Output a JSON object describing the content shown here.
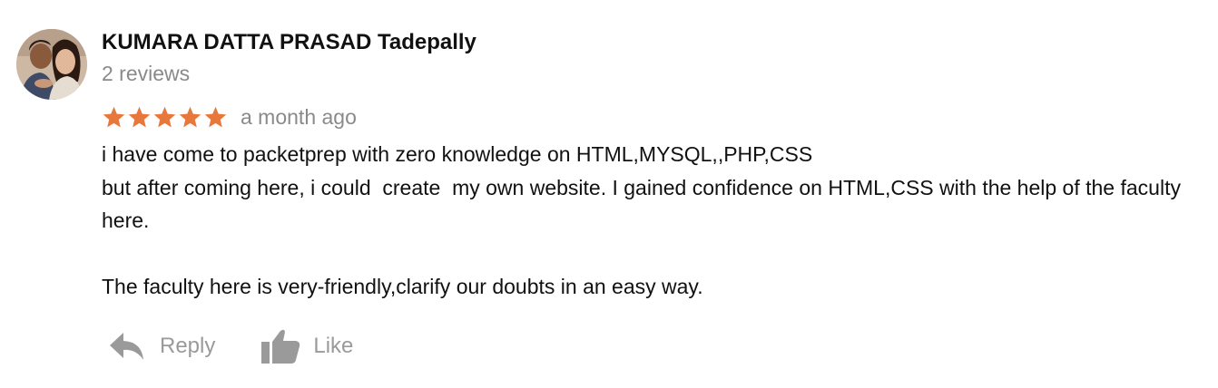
{
  "review": {
    "author_name": "KUMARA DATTA PRASAD Tadepally",
    "review_count": "2 reviews",
    "avatar_icon": "profile-photo",
    "rating": 5,
    "rating_max": 5,
    "star_color": "#e8773b",
    "time_ago": "a month ago",
    "body": {
      "line1": "i have come to packetprep with zero knowledge on HTML,MYSQL,,PHP,CSS",
      "paragraph1_rest": "but after coming here, i could  create  my own website. I gained confidence on HTML,CSS with the help of the faculty here.",
      "paragraph2": "The faculty here is very-friendly,clarify our doubts in an easy way."
    },
    "actions": {
      "reply_label": "Reply",
      "reply_icon": "reply-arrow-icon",
      "like_label": "Like",
      "like_icon": "thumbs-up-icon"
    }
  }
}
